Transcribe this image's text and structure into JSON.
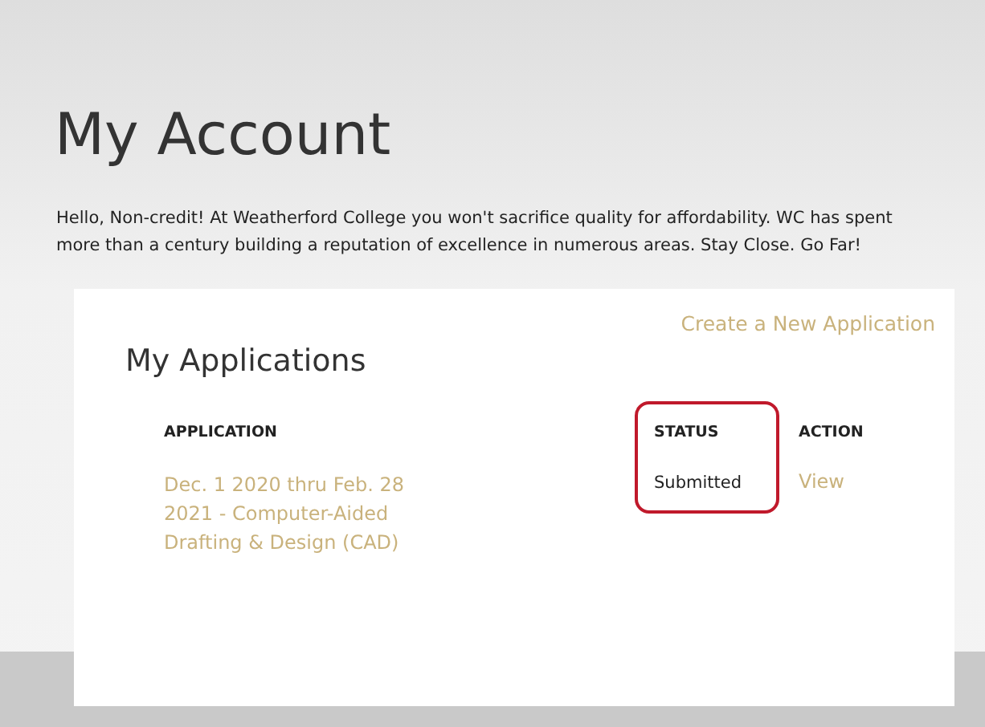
{
  "page": {
    "title": "My Account",
    "intro": "Hello, Non-credit! At Weatherford College you won't sacrifice quality for affordability. WC has spent more than a century building a reputation of excellence in numerous areas. Stay Close. Go Far!"
  },
  "applications": {
    "title": "My Applications",
    "create_link": "Create a New Application",
    "columns": [
      "APPLICATION",
      "STATUS",
      "ACTION"
    ],
    "rows": [
      {
        "application": "Dec. 1 2020 thru Feb. 28 2021 - Computer-Aided Drafting & Design (CAD)",
        "status": "Submitted",
        "action": "View"
      }
    ]
  }
}
